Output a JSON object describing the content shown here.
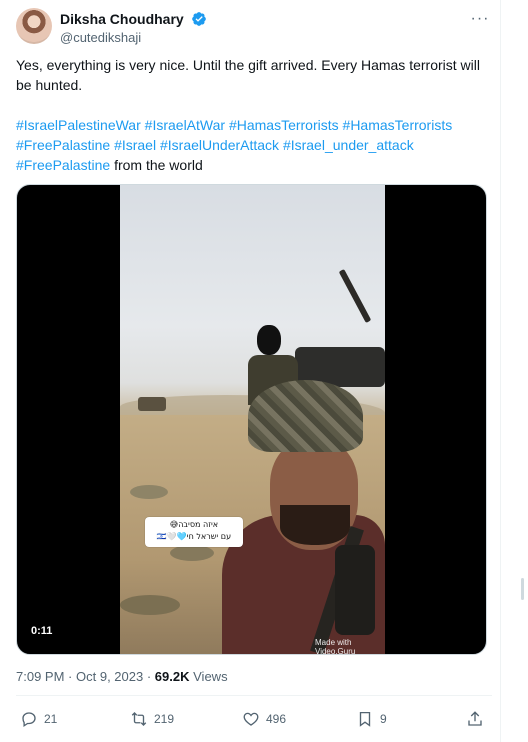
{
  "tweet": {
    "author": {
      "display_name": "Diksha Choudhary",
      "handle": "@cutedikshaji"
    },
    "text": "Yes, everything is very nice. Until the gift arrived. Every Hamas terrorist will be hunted.",
    "hashtags": [
      "#IsraelPalestineWar",
      "#IsraelAtWar",
      "#HamasTerrorists",
      "#HamasTerrorists",
      "#FreePalastine",
      "#Israel",
      "#IsraelUnderAttack",
      "#Israel_under_attack",
      "#FreePalastine"
    ],
    "trailing_text": "from the world",
    "media": {
      "duration": "0:11",
      "sticker_line1": "איזה מסיבה😅",
      "sticker_line2": "עם ישראל חי🩵🤍🇮🇱",
      "watermark_line1": "Made with",
      "watermark_line2": "Video.Guru"
    },
    "time": "7:09 PM",
    "date": "Oct 9, 2023",
    "views_count": "69.2K",
    "views_label": "Views",
    "stats": {
      "replies": "21",
      "reposts": "219",
      "likes": "496",
      "bookmarks": "9"
    }
  },
  "colors": {
    "link": "#1d9bf0",
    "verified": "#1d9bf0",
    "secondary_text": "#536471"
  },
  "icons": {
    "verified": "verified-badge-icon",
    "more": "more-dots-icon",
    "reply": "reply-icon",
    "repost": "repost-icon",
    "like": "like-heart-icon",
    "bookmark": "bookmark-icon",
    "share": "share-icon"
  }
}
